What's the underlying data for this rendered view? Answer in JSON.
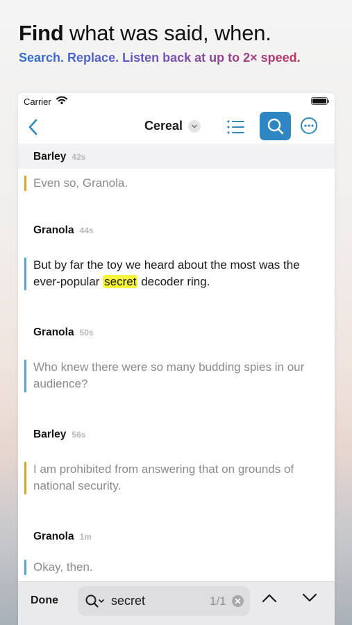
{
  "headline": {
    "bold": "Find",
    "rest": " what was said, when."
  },
  "subhead": "Search. Replace. Listen back at up to 2× speed.",
  "status": {
    "carrier": "Carrier"
  },
  "navbar": {
    "title": "Cereal"
  },
  "transcript": [
    {
      "speaker": "Barley",
      "time": "42s",
      "text": "Even so, Granola.",
      "color": "#f29a1f"
    },
    {
      "speaker": "Granola",
      "time": "44s",
      "text_before": "But by far the toy we heard about the most was the ever-popular ",
      "match": "secret",
      "text_after": " decoder ring.",
      "color": "#4ba9dc"
    },
    {
      "speaker": "Granola",
      "time": "50s",
      "text": "Who knew there were so many budding spies in our audience?",
      "color": "#4ba9dc"
    },
    {
      "speaker": "Barley",
      "time": "56s",
      "text": "I am prohibited from answering that on grounds of national security.",
      "color": "#f29a1f"
    },
    {
      "speaker": "Granola",
      "time": "1m",
      "text": "Okay, then.",
      "color": "#4ba9dc"
    }
  ],
  "find": {
    "done_label": "Done",
    "query": "secret",
    "count": "1/1"
  },
  "colors": {
    "accent": "#2e87c2",
    "highlight": "#f5f53b"
  }
}
